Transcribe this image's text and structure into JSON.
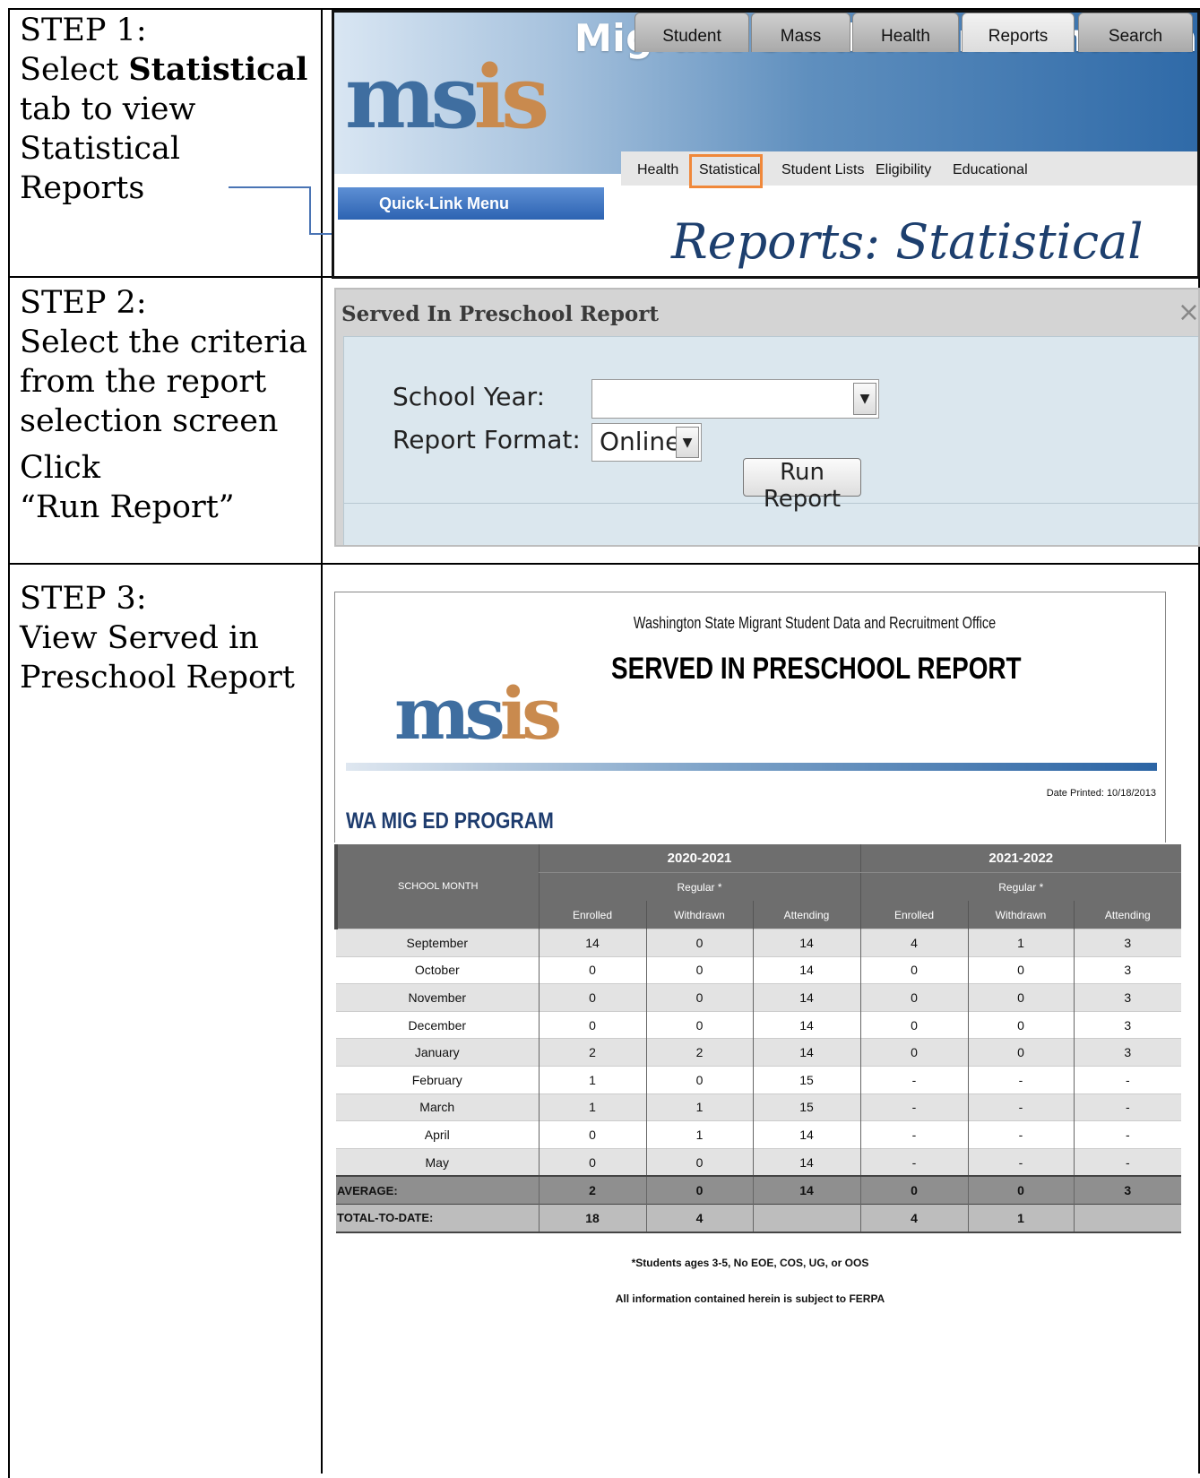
{
  "steps": {
    "step1": {
      "label": "STEP 1:",
      "text_a": "Select ",
      "bold": "Statistical",
      "text_b": "tab to view",
      "text_c": "Statistical",
      "text_d": "Reports"
    },
    "step2": {
      "label": "STEP 2:",
      "line1": "Select the criteria",
      "line2": "from the report",
      "line3": "selection screen",
      "click": "Click",
      "run": "“Run Report”"
    },
    "step3": {
      "label": "STEP 3:",
      "line1": "View Served in",
      "line2": "Preschool Report"
    }
  },
  "msis": {
    "title": "Migrant Student Information System",
    "logo": "msis",
    "tabs": [
      "Student",
      "Mass",
      "Health",
      "Reports",
      "Search"
    ],
    "active_tab": "Reports",
    "subtabs": [
      "Health",
      "Statistical",
      "Student Lists",
      "Eligibility",
      "Educational"
    ],
    "highlighted_subtab": "Statistical",
    "quick_link": "Quick-Link Menu",
    "page_heading": "Reports: Statistical",
    "colors": {
      "arrow": "#4a74b4",
      "highlight": "#f0883a",
      "brand_blue": "#2f6aa8"
    }
  },
  "dialog": {
    "title": "Served In Preschool Report",
    "close": "×",
    "school_year_label": "School Year:",
    "school_year_value": "",
    "report_format_label": "Report Format:",
    "report_format_value": "Online",
    "run_button": "Run Report"
  },
  "report": {
    "org": "Washington State Migrant Student Data and Recruitment Office",
    "title": "SERVED IN PRESCHOOL REPORT",
    "date_printed": "Date Printed: 10/18/2013",
    "program": "WA MIG ED PROGRAM",
    "month_header": "SCHOOL MONTH",
    "years": [
      "2020-2021",
      "2021-2022"
    ],
    "regular": "Regular *",
    "subheaders": [
      "Enrolled",
      "Withdrawn",
      "Attending"
    ],
    "rows": [
      [
        "September",
        "14",
        "0",
        "14",
        "4",
        "1",
        "3"
      ],
      [
        "October",
        "0",
        "0",
        "14",
        "0",
        "0",
        "3"
      ],
      [
        "November",
        "0",
        "0",
        "14",
        "0",
        "0",
        "3"
      ],
      [
        "December",
        "0",
        "0",
        "14",
        "0",
        "0",
        "3"
      ],
      [
        "January",
        "2",
        "2",
        "14",
        "0",
        "0",
        "3"
      ],
      [
        "February",
        "1",
        "0",
        "15",
        "-",
        "-",
        "-"
      ],
      [
        "March",
        "1",
        "1",
        "15",
        "-",
        "-",
        "-"
      ],
      [
        "April",
        "0",
        "1",
        "14",
        "-",
        "-",
        "-"
      ],
      [
        "May",
        "0",
        "0",
        "14",
        "-",
        "-",
        "-"
      ]
    ],
    "average": [
      "AVERAGE:",
      "2",
      "0",
      "14",
      "0",
      "0",
      "3"
    ],
    "total": [
      "TOTAL-TO-DATE:",
      "18",
      "4",
      "",
      "4",
      "1",
      ""
    ],
    "footnote": "*Students ages 3-5, No EOE, COS, UG, or OOS",
    "ferpa": "All information contained herein is subject to FERPA"
  }
}
